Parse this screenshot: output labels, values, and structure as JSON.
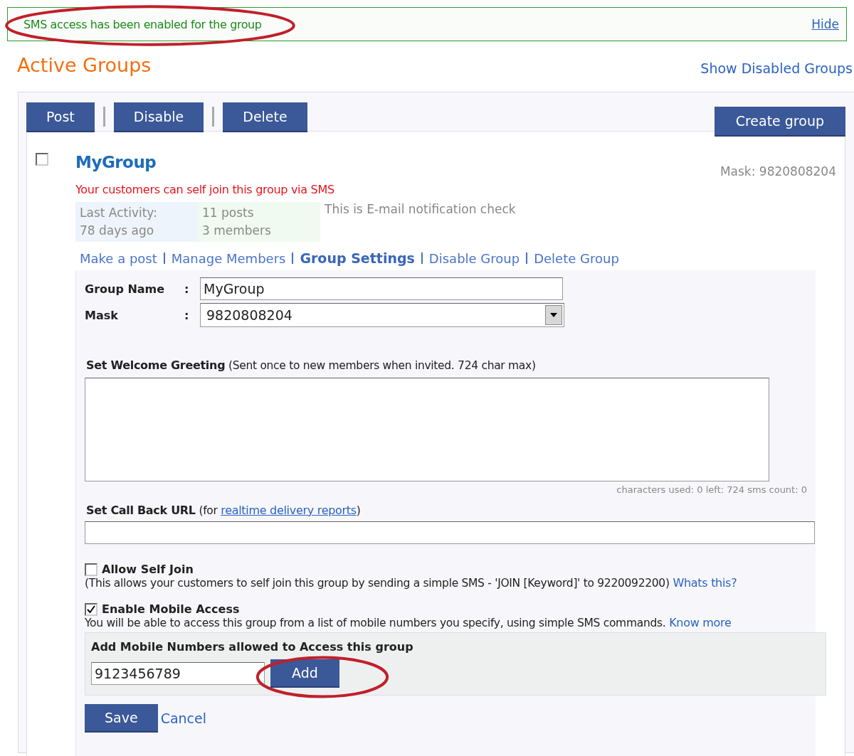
{
  "notice": {
    "message": "SMS access has been enabled for the group",
    "highlighted": true,
    "hide_link": "Hide"
  },
  "heading": "Active Groups",
  "show_disabled_link": "Show Disabled Groups",
  "toolbar": {
    "buttons": [
      "Post",
      "Disable",
      "Delete"
    ],
    "create_button": "Create group"
  },
  "group": {
    "checked": false,
    "name": "MyGroup",
    "self_join_note": "Your customers can self join this group via SMS",
    "mask": "Mask: 9820808204",
    "stats": [
      {
        "line1": "Last Activity:",
        "line2": "78 days ago",
        "color": "#eef4fb"
      },
      {
        "line1": "11 posts",
        "line2": "3 members",
        "color": "#f0faf0"
      }
    ],
    "email_note": "This is E-mail notification check",
    "links": [
      {
        "label": "Make a post",
        "selected": false
      },
      {
        "label": "Manage Members",
        "selected": false
      },
      {
        "label": "Group Settings",
        "selected": true
      },
      {
        "label": "Disable Group",
        "selected": false
      },
      {
        "label": "Delete Group",
        "selected": false
      }
    ]
  },
  "settings": {
    "fields": [
      {
        "label": "Group Name",
        "separator": ":",
        "kind": "text",
        "value": "MyGroup"
      },
      {
        "label": "Mask",
        "separator": ":",
        "kind": "select",
        "value": "9820808204"
      }
    ],
    "greeting": {
      "label": "Set Welcome Greeting",
      "note": "(Sent once to new members when invited. 724 char max)",
      "counter": "characters used: 0 left: 724 sms count: 0"
    },
    "callback": {
      "label": "Set Call Back URL",
      "note_before": "(for ",
      "link": "realtime delivery reports",
      "note_after": ")"
    },
    "options": [
      {
        "label": "Allow Self Join",
        "checked": false,
        "description": "(This allows your customers to self join this group by sending a simple SMS - 'JOIN [Keyword]' to 9220092200)",
        "link": "Whats this?"
      },
      {
        "label": "Enable Mobile Access",
        "checked": true,
        "description": "You will be able to access this group from a list of mobile numbers you specify, using simple SMS commands.",
        "link": "Know more"
      }
    ],
    "mobile": {
      "title": "Add Mobile Numbers allowed to Access this group",
      "value": "9123456789",
      "add_button": "Add",
      "highlighted": true
    },
    "save_button": "Save",
    "cancel_link": "Cancel"
  }
}
